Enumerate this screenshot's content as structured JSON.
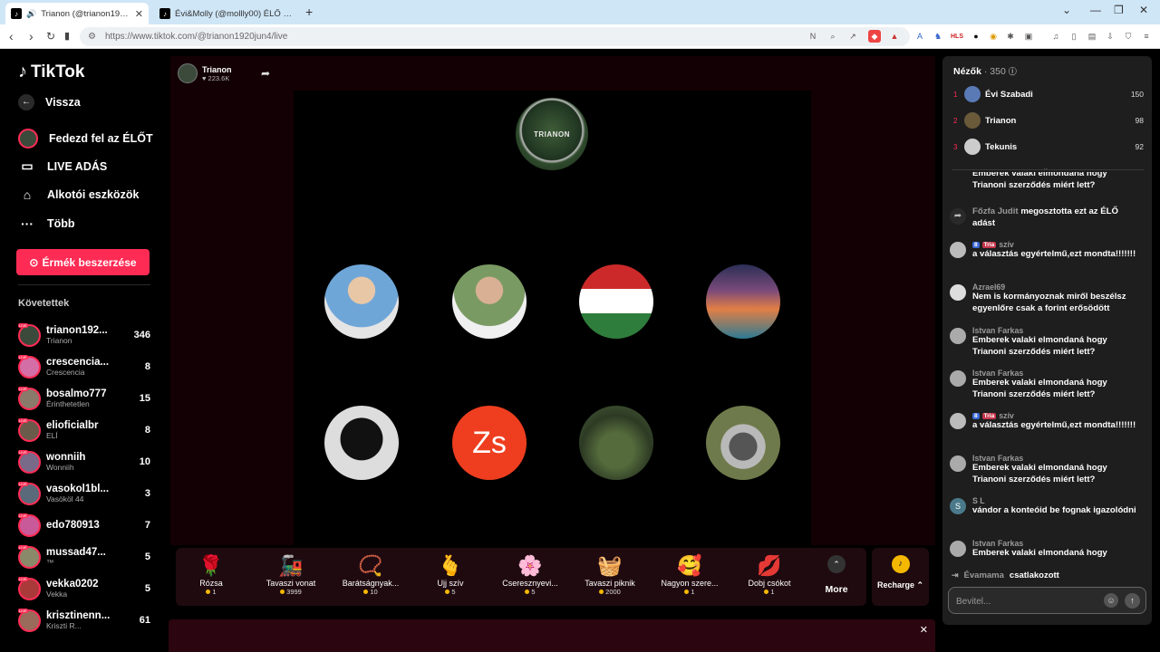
{
  "browser": {
    "tabs": [
      {
        "title": "Trianon (@trianon1920jun4) É",
        "active": true
      },
      {
        "title": "Évi&Molly (@mollly00) ÉLŐ adásban",
        "active": false
      }
    ],
    "new_tab": "+",
    "url": "https://www.tiktok.com/@trianon1920jun4/live",
    "ext_hls_label": "HLS"
  },
  "sidebar": {
    "logo": "TikTok",
    "back_label": "Vissza",
    "items": [
      {
        "label": "Fedezd fel az ÉLŐT",
        "icon": "live-explore-icon"
      },
      {
        "label": "LIVE ADÁS",
        "icon": "camera-icon"
      },
      {
        "label": "Alkotói eszközök",
        "icon": "creator-tools-icon"
      },
      {
        "label": "Több",
        "icon": "more-dots-icon"
      }
    ],
    "coins_button": "Érmék beszerzése",
    "following_title": "Követettek",
    "following": [
      {
        "username": "trianon192...",
        "display": "Trianon",
        "count": "346"
      },
      {
        "username": "crescencia...",
        "display": "Crescencia",
        "count": "8"
      },
      {
        "username": "bosalmo777",
        "display": "Érinthetetlen",
        "count": "15"
      },
      {
        "username": "elioficialbr",
        "display": "ELÍ",
        "count": "8"
      },
      {
        "username": "wonniih",
        "display": "Wonniih",
        "count": "10"
      },
      {
        "username": "vasokol1bl...",
        "display": "Vasököl 44",
        "count": "3"
      },
      {
        "username": "edo780913",
        "display": "",
        "count": "7"
      },
      {
        "username": "mussad47...",
        "display": "™",
        "count": "5"
      },
      {
        "username": "vekka0202",
        "display": "Vekka",
        "count": "5"
      },
      {
        "username": "krisztinenn...",
        "display": "Kriszti R...",
        "count": "61"
      }
    ]
  },
  "stream": {
    "host_name": "Trianon",
    "host_likes": "223.6K",
    "emblem_text": "TRIANON",
    "guests": [
      {
        "name": "guest-1"
      },
      {
        "name": "guest-2"
      },
      {
        "name": "guest-3"
      },
      {
        "name": "guest-4"
      },
      {
        "name": "guest-5"
      },
      {
        "name": "guest-6",
        "initials": "Zs"
      },
      {
        "name": "guest-7"
      },
      {
        "name": "guest-8"
      }
    ]
  },
  "gifts": [
    {
      "name": "Rózsa",
      "price": "1",
      "icon": "🌹"
    },
    {
      "name": "Tavaszi vonat",
      "price": "3999",
      "icon": "🚂"
    },
    {
      "name": "Barátságnyak...",
      "price": "10",
      "icon": "📿"
    },
    {
      "name": "Ujj szív",
      "price": "5",
      "icon": "🫰"
    },
    {
      "name": "Cseresznyevi...",
      "price": "5",
      "icon": "🌸"
    },
    {
      "name": "Tavaszi piknik",
      "price": "2000",
      "icon": "🧺"
    },
    {
      "name": "Nagyon szere...",
      "price": "1",
      "icon": "🥰"
    },
    {
      "name": "Dobj csókot",
      "price": "1",
      "icon": "💋"
    }
  ],
  "gift_more": "More",
  "recharge": "Recharge",
  "chat": {
    "viewers_label": "Nézők",
    "viewers_count": "· 350",
    "ranking": [
      {
        "rank": "1",
        "name": "Évi Szabadi",
        "score": "150"
      },
      {
        "rank": "2",
        "name": "Trianon",
        "score": "98"
      },
      {
        "rank": "3",
        "name": "Tekunis",
        "score": "92"
      }
    ],
    "messages": [
      {
        "name": "",
        "text": "Emberek valaki elmondaná hogy Trianoni szerződés miért lett?",
        "type": "partial"
      },
      {
        "name": "Főzfa Judit",
        "text": "megosztotta ezt az ÉLŐ adást",
        "type": "share"
      },
      {
        "name": "szív",
        "badge_lv": "8",
        "badge_fan": "Tria",
        "text": "a választás egyértelmű,ezt mondta!!!!!!!",
        "type": "normal"
      },
      {
        "name": "Azrael69",
        "text": "Nem is kormányoznak miről beszélsz egyenlőre csak a forint erősödött",
        "type": "normal"
      },
      {
        "name": "Istvan Farkas",
        "text": "Emberek valaki elmondaná hogy Trianoni szerződés miért lett?",
        "type": "normal"
      },
      {
        "name": "Istvan Farkas",
        "text": "Emberek valaki elmondaná hogy Trianoni szerződés miért lett?",
        "type": "normal"
      },
      {
        "name": "szív",
        "badge_lv": "8",
        "badge_fan": "Tria",
        "text": "a választás egyértelmű,ezt mondta!!!!!!!",
        "type": "normal"
      },
      {
        "name": "Istvan Farkas",
        "text": "Emberek valaki elmondaná hogy Trianoni szerződés miért lett?",
        "type": "normal"
      },
      {
        "name": "S L",
        "text": "vándor a konteóid be fognak igazolódni",
        "type": "normal"
      },
      {
        "name": "Istvan Farkas",
        "text": "Emberek valaki elmondaná hogy",
        "type": "normal"
      }
    ],
    "join": {
      "name": "Évamama",
      "text": "csatlakozott"
    },
    "input_placeholder": "Bevitel..."
  },
  "colors": {
    "accent": "#fe2c55",
    "coin": "#f5b800",
    "stage_bg": "#120004"
  }
}
